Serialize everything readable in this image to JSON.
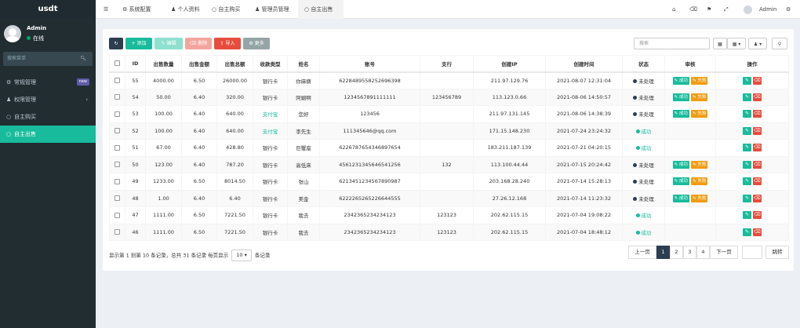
{
  "sidebar": {
    "logo": "usdt",
    "user_name": "Admin",
    "user_status": "在线",
    "search_placeholder": "搜索菜单",
    "items": [
      {
        "label": "常规管理",
        "badge": "new"
      },
      {
        "label": "权限管理"
      },
      {
        "label": "自主购买"
      },
      {
        "label": "自主出售"
      }
    ]
  },
  "topbar": {
    "tabs": [
      "系统配置",
      "个人资料",
      "自主购买",
      "管理员管理",
      "自主出售"
    ],
    "user": "Admin"
  },
  "toolbar": {
    "add": "添加",
    "edit": "编辑",
    "delete": "删除",
    "import": "导入",
    "more": "更多",
    "search_placeholder": "搜索"
  },
  "table": {
    "headers": [
      "ID",
      "出售数量",
      "出售金额",
      "出售总额",
      "收款类型",
      "姓名",
      "账号",
      "支行",
      "创建IP",
      "创建时间",
      "状态",
      "审核",
      "操作"
    ],
    "audit_ok": "成功",
    "audit_fail": "失败",
    "rows": [
      {
        "id": "55",
        "qty": "4000.00",
        "price": "6.50",
        "total": "26000.00",
        "type": "银行卡",
        "name": "你麻痹",
        "account": "6228489558252696398",
        "branch": "",
        "ip": "211.97.129.76",
        "time": "2021-08-07 12:31:04",
        "status": "未处理"
      },
      {
        "id": "54",
        "qty": "50.00",
        "price": "6.40",
        "total": "320.00",
        "type": "银行卡",
        "name": "阿姻啊",
        "account": "1234567891111111",
        "branch": "123456789",
        "ip": "113.123.0.66",
        "time": "2021-08-06 14:50:57",
        "status": "未处理"
      },
      {
        "id": "53",
        "qty": "100.00",
        "price": "6.40",
        "total": "640.00",
        "type": "支付宝",
        "name": "您好",
        "account": "123456",
        "branch": "",
        "ip": "211.97.131.145",
        "time": "2021-08-06 14:38:39",
        "status": "未处理"
      },
      {
        "id": "52",
        "qty": "100.00",
        "price": "6.40",
        "total": "640.00",
        "type": "支付宝",
        "name": "李先生",
        "account": "111345646@qq.com",
        "branch": "",
        "ip": "171.15.148.230",
        "time": "2021-07-24 23:24:32",
        "status": "成功"
      },
      {
        "id": "51",
        "qty": "67.00",
        "price": "6.40",
        "total": "428.80",
        "type": "银行卡",
        "name": "巨蟹座",
        "account": "6226787654346897654",
        "branch": "",
        "ip": "183.211.187.139",
        "time": "2021-07-21 04:20:15",
        "status": "成功"
      },
      {
        "id": "50",
        "qty": "123.00",
        "price": "6.40",
        "total": "787.20",
        "type": "银行卡",
        "name": "高低床",
        "account": "4561231345646541256",
        "branch": "132",
        "ip": "113.100.44.44",
        "time": "2021-07-15 20:24:42",
        "status": "未处理"
      },
      {
        "id": "49",
        "qty": "1233.00",
        "price": "6.50",
        "total": "8014.50",
        "type": "银行卡",
        "name": "张山",
        "account": "6213451234567890987",
        "branch": "",
        "ip": "203.168.28.240",
        "time": "2021-07-14 15:28:13",
        "status": "未处理"
      },
      {
        "id": "48",
        "qty": "1.00",
        "price": "6.40",
        "total": "6.40",
        "type": "银行卡",
        "name": "美金",
        "account": "6222265265226644555",
        "branch": "",
        "ip": "27.26.12.168",
        "time": "2021-07-14 11:23:32",
        "status": "未处理"
      },
      {
        "id": "47",
        "qty": "1111.00",
        "price": "6.50",
        "total": "7221.50",
        "type": "银行卡",
        "name": "我去",
        "account": "2342365234234123",
        "branch": "123123",
        "ip": "202.62.115.15",
        "time": "2021-07-04 19:08:22",
        "status": "成功"
      },
      {
        "id": "46",
        "qty": "1111.00",
        "price": "6.50",
        "total": "7221.50",
        "type": "银行卡",
        "name": "我去",
        "account": "2342365234234123",
        "branch": "123123",
        "ip": "202.62.115.15",
        "time": "2021-07-04 18:48:12",
        "status": "成功"
      }
    ]
  },
  "footer": {
    "info_before": "显示第 1 到第 10 条记录，总共 31 条记录 每页显示",
    "page_size": "10",
    "info_after": "条记录"
  },
  "pager": {
    "prev": "上一页",
    "pages": [
      "1",
      "2",
      "3",
      "4"
    ],
    "next": "下一页",
    "jump": "跳转"
  }
}
